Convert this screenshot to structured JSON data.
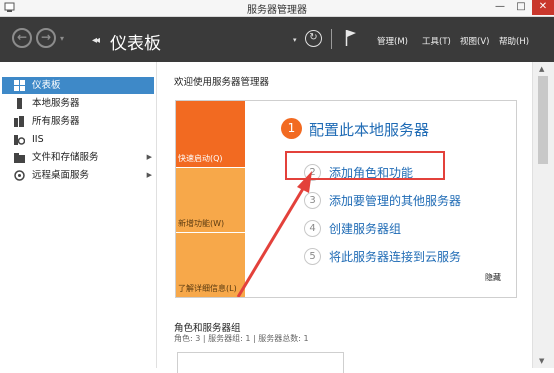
{
  "window": {
    "title": "服务器管理器",
    "minimize_glyph": "—",
    "maximize_glyph": "□",
    "close_glyph": "✕"
  },
  "header": {
    "back_glyph": "←",
    "forward_glyph": "→",
    "dropdown_glyph": "▾",
    "breadcrumb_arrows": "◂◂",
    "breadcrumb_title": "仪表板",
    "refresh_glyph": "↻",
    "menus": [
      "管理(M)",
      "工具(T)",
      "视图(V)",
      "帮助(H)"
    ]
  },
  "sidebar": {
    "items": [
      {
        "label": "仪表板",
        "icon": "dashboard-icon",
        "selected": true,
        "expandable": false
      },
      {
        "label": "本地服务器",
        "icon": "server-icon",
        "selected": false,
        "expandable": false
      },
      {
        "label": "所有服务器",
        "icon": "servers-icon",
        "selected": false,
        "expandable": false
      },
      {
        "label": "IIS",
        "icon": "iis-icon",
        "selected": false,
        "expandable": false
      },
      {
        "label": "文件和存储服务",
        "icon": "file-storage-icon",
        "selected": false,
        "expandable": true
      },
      {
        "label": "远程桌面服务",
        "icon": "remote-desktop-icon",
        "selected": false,
        "expandable": true
      }
    ],
    "chevron_glyph": "▶"
  },
  "main": {
    "welcome_title": "欢迎使用服务器管理器",
    "tiles": {
      "quick_start": "快速启动(Q)",
      "whats_new": "新增功能(W)",
      "learn_more": "了解详细信息(L)"
    },
    "steps": [
      {
        "num": "1",
        "label": "配置此本地服务器"
      },
      {
        "num": "2",
        "label": "添加角色和功能"
      },
      {
        "num": "3",
        "label": "添加要管理的其他服务器"
      },
      {
        "num": "4",
        "label": "创建服务器组"
      },
      {
        "num": "5",
        "label": "将此服务器连接到云服务"
      }
    ],
    "hide_label": "隐藏",
    "roles_title": "角色和服务器组",
    "roles_counts": "角色: 3 | 服务器组: 1 | 服务器总数: 1"
  },
  "colors": {
    "header_bg": "#3a3a3a",
    "accent_blue": "#1f6bb5",
    "selected_bg": "#3e89c8",
    "tile_orange": "#f26a21",
    "tile_light_orange": "#f7a84a",
    "annotation_red": "#e3413b"
  },
  "scrollbar": {
    "up_glyph": "▲",
    "down_glyph": "▼"
  }
}
